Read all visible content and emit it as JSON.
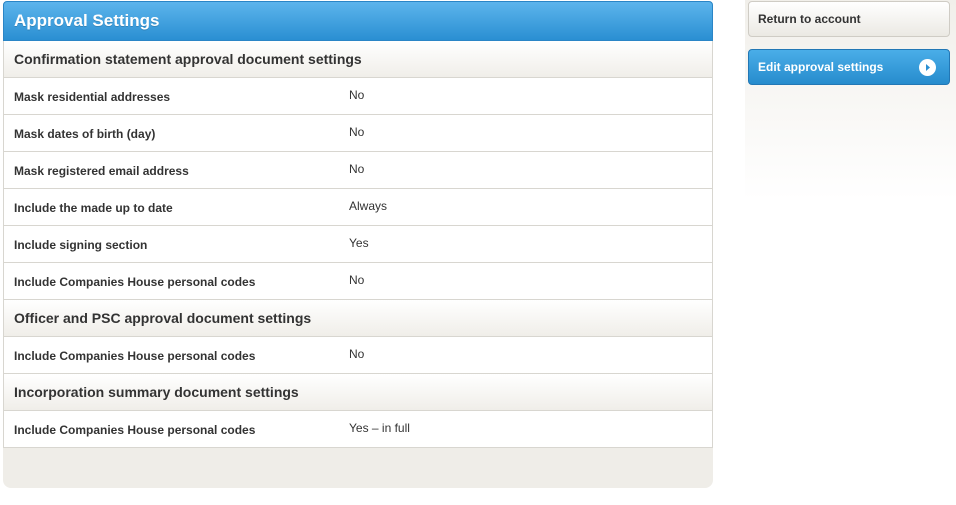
{
  "panel": {
    "title": "Approval Settings"
  },
  "sections": [
    {
      "heading": "Confirmation statement approval document settings",
      "rows": [
        {
          "label": "Mask residential addresses",
          "value": "No"
        },
        {
          "label": "Mask dates of birth (day)",
          "value": "No"
        },
        {
          "label": "Mask registered email address",
          "value": "No"
        },
        {
          "label": "Include the made up to date",
          "value": "Always"
        },
        {
          "label": "Include signing section",
          "value": "Yes"
        },
        {
          "label": "Include Companies House personal codes",
          "value": "No"
        }
      ]
    },
    {
      "heading": "Officer and PSC approval document settings",
      "rows": [
        {
          "label": "Include Companies House personal codes",
          "value": "No"
        }
      ]
    },
    {
      "heading": "Incorporation summary document settings",
      "rows": [
        {
          "label": "Include Companies House personal codes",
          "value": "Yes – in full"
        }
      ]
    }
  ],
  "sidebar": {
    "return_label": "Return to account",
    "edit_label": "Edit approval settings",
    "edit_icon": "chevron-right-circle-icon",
    "accent_color": "#2a8fd2"
  }
}
